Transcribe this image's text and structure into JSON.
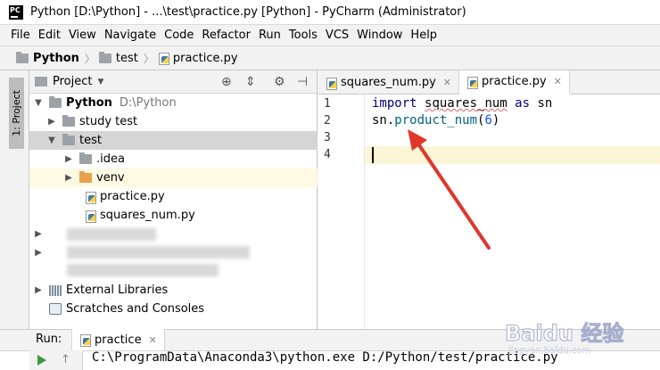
{
  "window": {
    "title": "Python [D:\\Python] - ...\\test\\practice.py [Python] - PyCharm (Administrator)",
    "logo": "PC"
  },
  "menu": [
    "File",
    "Edit",
    "View",
    "Navigate",
    "Code",
    "Refactor",
    "Run",
    "Tools",
    "VCS",
    "Window",
    "Help"
  ],
  "breadcrumb": {
    "root": "Python",
    "folder": "test",
    "file": "practice.py"
  },
  "left_strip": {
    "label": "1: Project"
  },
  "project": {
    "header": "Project",
    "tree": {
      "root_name": "Python",
      "root_path": "D:\\Python",
      "study_test": "study test",
      "test": "test",
      "idea": ".idea",
      "venv": "venv",
      "practice": "practice.py",
      "squares": "squares_num.py",
      "external": "External Libraries",
      "scratches": "Scratches and Consoles"
    }
  },
  "tabs": [
    {
      "label": "squares_num.py"
    },
    {
      "label": "practice.py"
    }
  ],
  "editor": {
    "line_numbers": [
      "1",
      "2",
      "3",
      "4"
    ],
    "code": {
      "l1_kw": "import",
      "l1_mod": "squares_num",
      "l1_as": "as",
      "l1_alias": "sn",
      "l2_obj": "sn.",
      "l2_fn": "product_num",
      "l2_open": "(",
      "l2_arg": "6",
      "l2_close": ")"
    }
  },
  "run": {
    "label": "Run:",
    "tab": "practice",
    "output": "C:\\ProgramData\\Anaconda3\\python.exe D:/Python/test/practice.py"
  },
  "watermark": {
    "text": "Baidu 经验",
    "sub": "jingyan.baidu.com"
  },
  "colors": {
    "arrow": "#e0362c",
    "keyword": "#000080",
    "function": "#00627a",
    "number": "#1750eb",
    "current_line": "#fcf5d6",
    "selection": "#d5d5d5"
  }
}
